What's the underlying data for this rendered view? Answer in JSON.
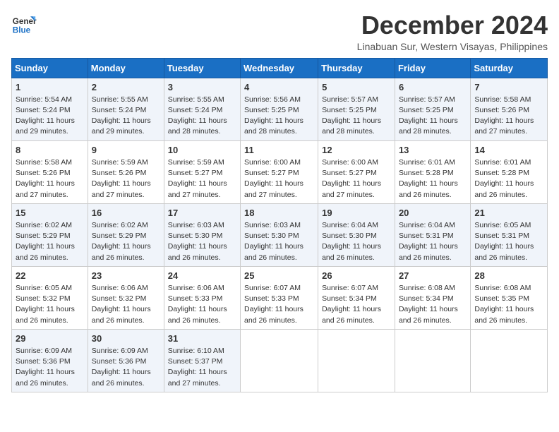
{
  "logo": {
    "text_general": "General",
    "text_blue": "Blue"
  },
  "header": {
    "month": "December 2024",
    "location": "Linabuan Sur, Western Visayas, Philippines"
  },
  "weekdays": [
    "Sunday",
    "Monday",
    "Tuesday",
    "Wednesday",
    "Thursday",
    "Friday",
    "Saturday"
  ],
  "weeks": [
    [
      {
        "day": "1",
        "detail": "Sunrise: 5:54 AM\nSunset: 5:24 PM\nDaylight: 11 hours\nand 29 minutes."
      },
      {
        "day": "2",
        "detail": "Sunrise: 5:55 AM\nSunset: 5:24 PM\nDaylight: 11 hours\nand 29 minutes."
      },
      {
        "day": "3",
        "detail": "Sunrise: 5:55 AM\nSunset: 5:24 PM\nDaylight: 11 hours\nand 28 minutes."
      },
      {
        "day": "4",
        "detail": "Sunrise: 5:56 AM\nSunset: 5:25 PM\nDaylight: 11 hours\nand 28 minutes."
      },
      {
        "day": "5",
        "detail": "Sunrise: 5:57 AM\nSunset: 5:25 PM\nDaylight: 11 hours\nand 28 minutes."
      },
      {
        "day": "6",
        "detail": "Sunrise: 5:57 AM\nSunset: 5:25 PM\nDaylight: 11 hours\nand 28 minutes."
      },
      {
        "day": "7",
        "detail": "Sunrise: 5:58 AM\nSunset: 5:26 PM\nDaylight: 11 hours\nand 27 minutes."
      }
    ],
    [
      {
        "day": "8",
        "detail": "Sunrise: 5:58 AM\nSunset: 5:26 PM\nDaylight: 11 hours\nand 27 minutes."
      },
      {
        "day": "9",
        "detail": "Sunrise: 5:59 AM\nSunset: 5:26 PM\nDaylight: 11 hours\nand 27 minutes."
      },
      {
        "day": "10",
        "detail": "Sunrise: 5:59 AM\nSunset: 5:27 PM\nDaylight: 11 hours\nand 27 minutes."
      },
      {
        "day": "11",
        "detail": "Sunrise: 6:00 AM\nSunset: 5:27 PM\nDaylight: 11 hours\nand 27 minutes."
      },
      {
        "day": "12",
        "detail": "Sunrise: 6:00 AM\nSunset: 5:27 PM\nDaylight: 11 hours\nand 27 minutes."
      },
      {
        "day": "13",
        "detail": "Sunrise: 6:01 AM\nSunset: 5:28 PM\nDaylight: 11 hours\nand 26 minutes."
      },
      {
        "day": "14",
        "detail": "Sunrise: 6:01 AM\nSunset: 5:28 PM\nDaylight: 11 hours\nand 26 minutes."
      }
    ],
    [
      {
        "day": "15",
        "detail": "Sunrise: 6:02 AM\nSunset: 5:29 PM\nDaylight: 11 hours\nand 26 minutes."
      },
      {
        "day": "16",
        "detail": "Sunrise: 6:02 AM\nSunset: 5:29 PM\nDaylight: 11 hours\nand 26 minutes."
      },
      {
        "day": "17",
        "detail": "Sunrise: 6:03 AM\nSunset: 5:30 PM\nDaylight: 11 hours\nand 26 minutes."
      },
      {
        "day": "18",
        "detail": "Sunrise: 6:03 AM\nSunset: 5:30 PM\nDaylight: 11 hours\nand 26 minutes."
      },
      {
        "day": "19",
        "detail": "Sunrise: 6:04 AM\nSunset: 5:30 PM\nDaylight: 11 hours\nand 26 minutes."
      },
      {
        "day": "20",
        "detail": "Sunrise: 6:04 AM\nSunset: 5:31 PM\nDaylight: 11 hours\nand 26 minutes."
      },
      {
        "day": "21",
        "detail": "Sunrise: 6:05 AM\nSunset: 5:31 PM\nDaylight: 11 hours\nand 26 minutes."
      }
    ],
    [
      {
        "day": "22",
        "detail": "Sunrise: 6:05 AM\nSunset: 5:32 PM\nDaylight: 11 hours\nand 26 minutes."
      },
      {
        "day": "23",
        "detail": "Sunrise: 6:06 AM\nSunset: 5:32 PM\nDaylight: 11 hours\nand 26 minutes."
      },
      {
        "day": "24",
        "detail": "Sunrise: 6:06 AM\nSunset: 5:33 PM\nDaylight: 11 hours\nand 26 minutes."
      },
      {
        "day": "25",
        "detail": "Sunrise: 6:07 AM\nSunset: 5:33 PM\nDaylight: 11 hours\nand 26 minutes."
      },
      {
        "day": "26",
        "detail": "Sunrise: 6:07 AM\nSunset: 5:34 PM\nDaylight: 11 hours\nand 26 minutes."
      },
      {
        "day": "27",
        "detail": "Sunrise: 6:08 AM\nSunset: 5:34 PM\nDaylight: 11 hours\nand 26 minutes."
      },
      {
        "day": "28",
        "detail": "Sunrise: 6:08 AM\nSunset: 5:35 PM\nDaylight: 11 hours\nand 26 minutes."
      }
    ],
    [
      {
        "day": "29",
        "detail": "Sunrise: 6:09 AM\nSunset: 5:36 PM\nDaylight: 11 hours\nand 26 minutes."
      },
      {
        "day": "30",
        "detail": "Sunrise: 6:09 AM\nSunset: 5:36 PM\nDaylight: 11 hours\nand 26 minutes."
      },
      {
        "day": "31",
        "detail": "Sunrise: 6:10 AM\nSunset: 5:37 PM\nDaylight: 11 hours\nand 27 minutes."
      },
      {
        "day": "",
        "detail": ""
      },
      {
        "day": "",
        "detail": ""
      },
      {
        "day": "",
        "detail": ""
      },
      {
        "day": "",
        "detail": ""
      }
    ]
  ]
}
